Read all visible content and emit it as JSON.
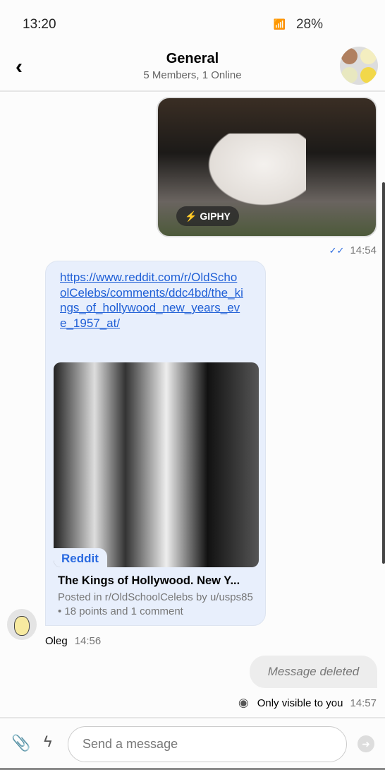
{
  "status": {
    "time": "13:20",
    "battery": "28%"
  },
  "header": {
    "title": "General",
    "subtitle": "5 Members, 1 Online"
  },
  "messages": {
    "gif": {
      "badge": "GIPHY",
      "time": "14:54"
    },
    "link": {
      "url": "https://www.reddit.com/r/OldSchoolCelebs/comments/ddc4bd/the_kings_of_hollywood_new_years_eve_1957_at/",
      "source": "Reddit",
      "title": "The Kings of Hollywood. New Y...",
      "description": "Posted in r/OldSchoolCelebs by u/usps85 • 18 points and 1 comment",
      "author": "Oleg",
      "time": "14:56"
    },
    "deleted": {
      "text": "Message deleted",
      "visibility": "Only visible to you",
      "time": "14:57"
    }
  },
  "composer": {
    "placeholder": "Send a message"
  }
}
